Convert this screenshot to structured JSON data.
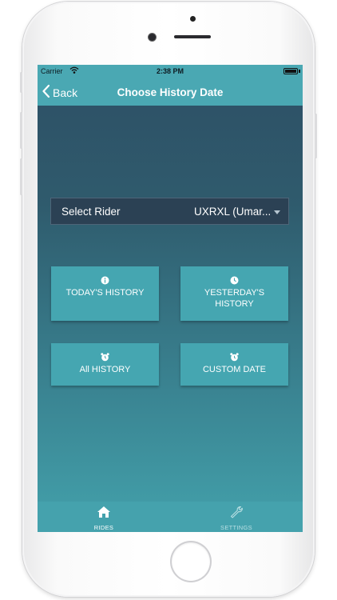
{
  "status_bar": {
    "carrier": "Carrier",
    "time": "2:38 PM"
  },
  "nav": {
    "back_label": "Back",
    "title": "Choose History Date"
  },
  "rider_select": {
    "label": "Select Rider",
    "value": "UXRXL (Umar..."
  },
  "tiles": [
    {
      "label": "TODAY'S HISTORY",
      "icon": "info-icon"
    },
    {
      "label": "YESTERDAY'S HISTORY",
      "icon": "clock-icon"
    },
    {
      "label": "All HISTORY",
      "icon": "alarm-clock-icon"
    },
    {
      "label": "CUSTOM DATE",
      "icon": "alarm-clock-icon"
    }
  ],
  "tabs": [
    {
      "label": "RIDES",
      "icon": "house-icon",
      "active": true
    },
    {
      "label": "SETTINGS",
      "icon": "wrench-icon",
      "active": false
    }
  ],
  "colors": {
    "accent": "#4aa8b3",
    "tile": "#45a6b1",
    "select_bg": "#2b4154"
  }
}
